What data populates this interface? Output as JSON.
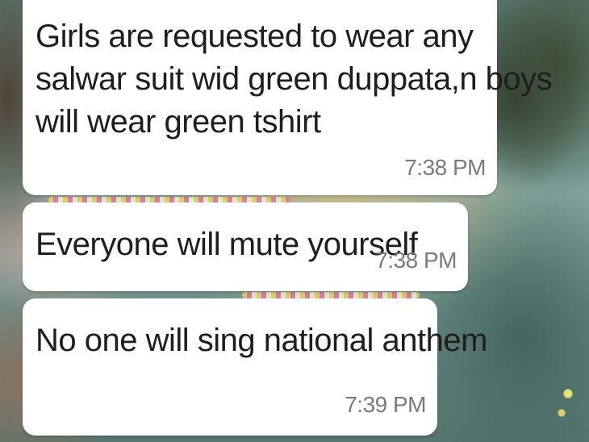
{
  "messages": [
    {
      "lines": [
        "Girls are requested to wear any",
        "salwar suit wid green duppata,n boys",
        "will wear green tshirt"
      ],
      "time": "7:38 PM"
    },
    {
      "lines": [
        "Everyone will mute yourself"
      ],
      "time": "7:38 PM"
    },
    {
      "lines": [
        "No one will sing national anthem"
      ],
      "time": "7:39 PM"
    }
  ],
  "colors": {
    "bubble": "#ffffff",
    "text": "#1e1e1e",
    "timestamp": "#7a7a7a"
  }
}
